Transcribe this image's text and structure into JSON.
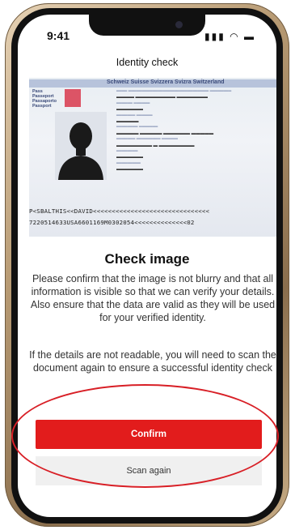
{
  "status_bar": {
    "time": "9:41",
    "icons": "signal-wifi-battery"
  },
  "header": {
    "title": "Identity check"
  },
  "passport": {
    "header_text": "Schweiz Suisse Svizzera Svizra Switzerland",
    "labels": [
      "Pass",
      "Passeport",
      "Passaporto",
      "Passport"
    ],
    "mrz_line1": "P<SBALTHIS<<DAVID<<<<<<<<<<<<<<<<<<<<<<<<<<<<<<<",
    "mrz_line2": "7220514633USA6601169M0302054<<<<<<<<<<<<<<02"
  },
  "content": {
    "heading": "Check image",
    "paragraph1": "Please confirm that the image is not blurry and that all information is visible so that we can verify your details. Also ensure that the data are valid as they will be used for your verified identity.",
    "paragraph2": "If the details are not readable, you will need to scan the document again to ensure a successful identity check"
  },
  "actions": {
    "confirm_label": "Confirm",
    "scan_again_label": "Scan again"
  },
  "colors": {
    "accent": "#e21c1c",
    "secondary_bg": "#f0f0f0",
    "highlight": "#d81f26"
  }
}
